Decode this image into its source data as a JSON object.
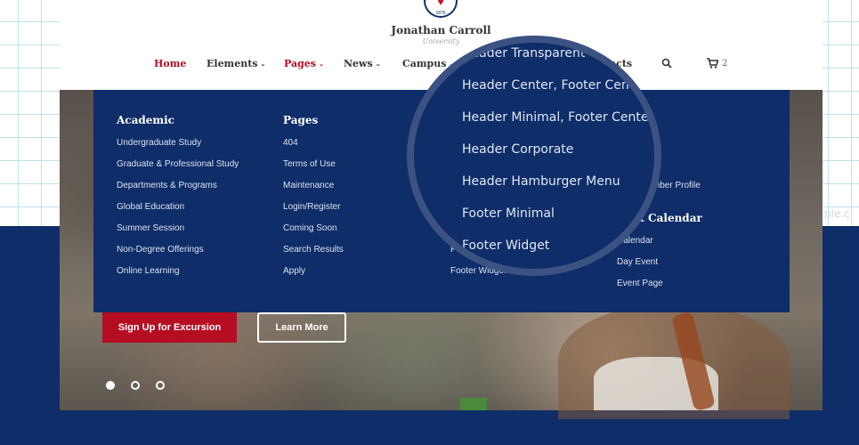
{
  "background": {
    "faded_text": "ple.c"
  },
  "header": {
    "logo": {
      "year": "1876",
      "title": "Jonathan Carroll",
      "subtitle": "University"
    },
    "nav": [
      {
        "label": "Home",
        "active": true,
        "caret": false
      },
      {
        "label": "Elements",
        "active": false,
        "caret": true
      },
      {
        "label": "Pages",
        "active": true,
        "caret": true
      },
      {
        "label": "News",
        "active": false,
        "caret": true
      },
      {
        "label": "Campus",
        "active": false,
        "caret": true
      },
      {
        "label": "acts",
        "active": false,
        "caret": false
      }
    ],
    "search_icon": "search-icon",
    "cart_icon": "cart-icon",
    "cart_count": "2"
  },
  "mega_menu": {
    "columns": [
      {
        "title": "Academic",
        "links": [
          "Undergraduate Study",
          "Graduate & Professional Study",
          "Departments & Programs",
          "Global Education",
          "Summer Session",
          "Non-Degree Offerings",
          "Online Learning"
        ]
      },
      {
        "title": "Pages",
        "links": [
          "404",
          "Terms of Use",
          "Maintenance",
          "Login/Register",
          "Coming Soon",
          "Search Results",
          "Apply"
        ]
      },
      {
        "title": "",
        "links": [
          "Footer :",
          "Footer Widget"
        ]
      },
      {
        "title": "t",
        "links": [
          "Member Profile"
        ],
        "subsection": {
          "title": "vent Calendar",
          "links": [
            "Calendar",
            "Day Event",
            "Event Page"
          ]
        }
      }
    ]
  },
  "zoom": {
    "items": [
      "Header Transparent",
      "Header Center, Footer Center",
      "Header Minimal, Footer Center",
      "Header Corporate",
      "Header Hamburger Menu",
      "Footer Minimal",
      "Footer Widget"
    ]
  },
  "hero": {
    "primary_button": "Sign Up for Excursion",
    "secondary_button": "Learn More",
    "slides": 3,
    "active_slide": 0
  },
  "colors": {
    "navy": "#0f2d68",
    "accent_red": "#b50d22",
    "grid": "#bfe2ea"
  }
}
